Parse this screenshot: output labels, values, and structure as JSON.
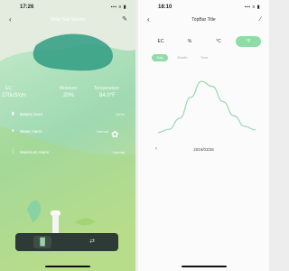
{
  "left_screen": {
    "status": {
      "time": "17:26",
      "signal": "▪▪▪ ≡ ▮"
    },
    "nav": {
      "back": "‹",
      "title": "Solar Soil Sensor",
      "edit": "✎"
    },
    "readings": [
      {
        "label": "EC",
        "value": "270uS/cm"
      },
      {
        "label": "Moisture",
        "value": "20%"
      },
      {
        "label": "Temperature",
        "value": "84.0°F"
      }
    ],
    "rows": [
      {
        "icon": "battery-icon",
        "glyph": "▮",
        "label": "Battery level",
        "status": "100%"
      },
      {
        "icon": "water-drop-icon",
        "glyph": "♦",
        "label": "Water Alarm",
        "status": "Normal"
      },
      {
        "icon": "thermometer-icon",
        "glyph": "│",
        "label": "Maximum Alarm",
        "status": "Normal"
      }
    ],
    "bottom_nav": {
      "chart_glyph": "▐▌",
      "swap_glyph": "⇄"
    }
  },
  "right_screen": {
    "status": {
      "time": "18:10",
      "signal": "▪▪▪ ≡ ▮"
    },
    "nav": {
      "back": "‹",
      "title": "TopBar Title",
      "edit": "∕"
    },
    "metric_tabs": [
      "EC",
      "%",
      "°C",
      "°F"
    ],
    "active_metric": 3,
    "period_tabs": [
      "Day",
      "Month",
      "Year"
    ],
    "active_period": 0,
    "date_prev": "‹",
    "date": "2024/03/26",
    "colors": {
      "accent": "#8fdca6",
      "line": "#9ad7ae"
    },
    "chart_data": {
      "type": "line",
      "title": "",
      "xlabel": "",
      "ylabel": "",
      "y_ticks": [
        "",
        "",
        "",
        "",
        ""
      ],
      "series": [
        {
          "values": [
            5,
            10,
            28,
            62,
            88,
            80,
            55,
            32,
            15,
            9
          ]
        }
      ],
      "ylim": [
        0,
        100
      ],
      "grid": false
    }
  }
}
